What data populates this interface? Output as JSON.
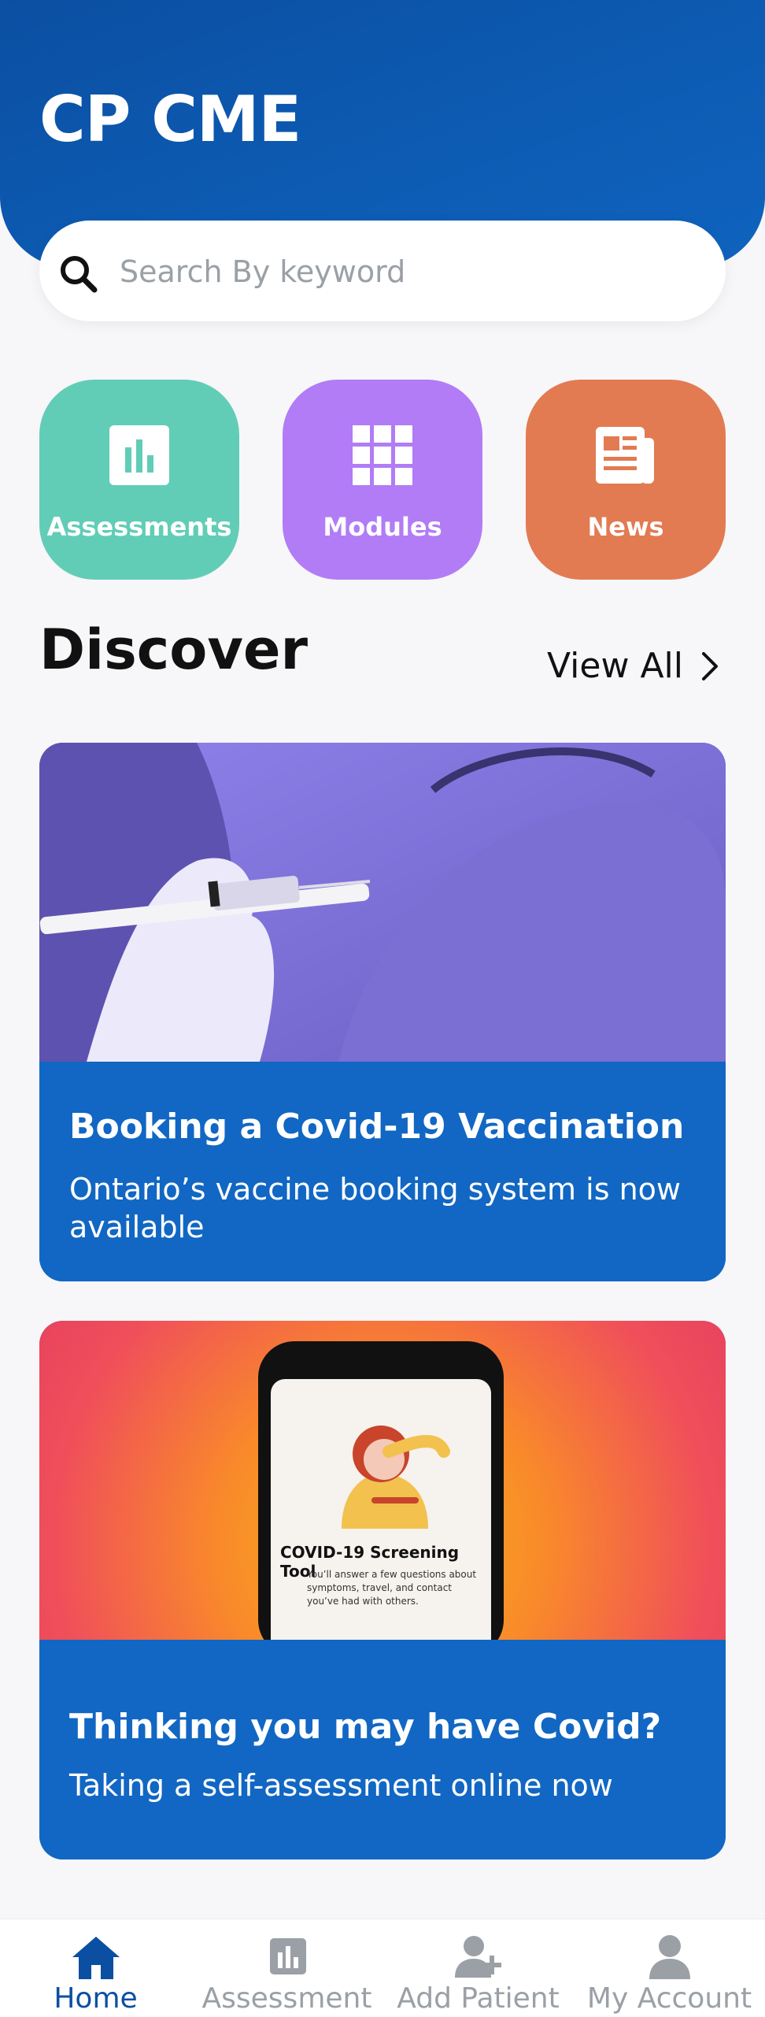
{
  "app": {
    "title": "CP CME"
  },
  "search": {
    "placeholder": "Search By keyword",
    "icon": "search-icon"
  },
  "quick_links": [
    {
      "label": "Assessments",
      "icon": "bar-chart-icon",
      "color": "#62cdb6"
    },
    {
      "label": "Modules",
      "icon": "grid-icon",
      "color": "#b17cf6"
    },
    {
      "label": "News",
      "icon": "newspaper-icon",
      "color": "#e27b52"
    }
  ],
  "discover": {
    "title": "Discover",
    "view_all": "View All",
    "cards": [
      {
        "title": "Booking a Covid-19 Vaccination",
        "description": "Ontario’s vaccine booking system is now available",
        "image": "vaccination-photo"
      },
      {
        "title": "Thinking you may have Covid?",
        "description": "Taking a self-assessment online now",
        "image": "phone-screening-tool-photo",
        "image_text": {
          "heading": "COVID-19 Screening Tool",
          "body": "You’ll answer a few questions about symptoms, travel, and contact you’ve had with others."
        }
      }
    ]
  },
  "bottom_nav": {
    "items": [
      {
        "label": "Home",
        "icon": "home-icon",
        "active": true
      },
      {
        "label": "Assessment",
        "icon": "bar-chart-icon",
        "active": false
      },
      {
        "label": "Add Patient",
        "icon": "add-user-icon",
        "active": false
      },
      {
        "label": "My Account",
        "icon": "user-icon",
        "active": false
      }
    ]
  },
  "colors": {
    "primary": "#0b4fa2",
    "card_blue": "#1167c3",
    "inactive": "#9aa0a6"
  }
}
